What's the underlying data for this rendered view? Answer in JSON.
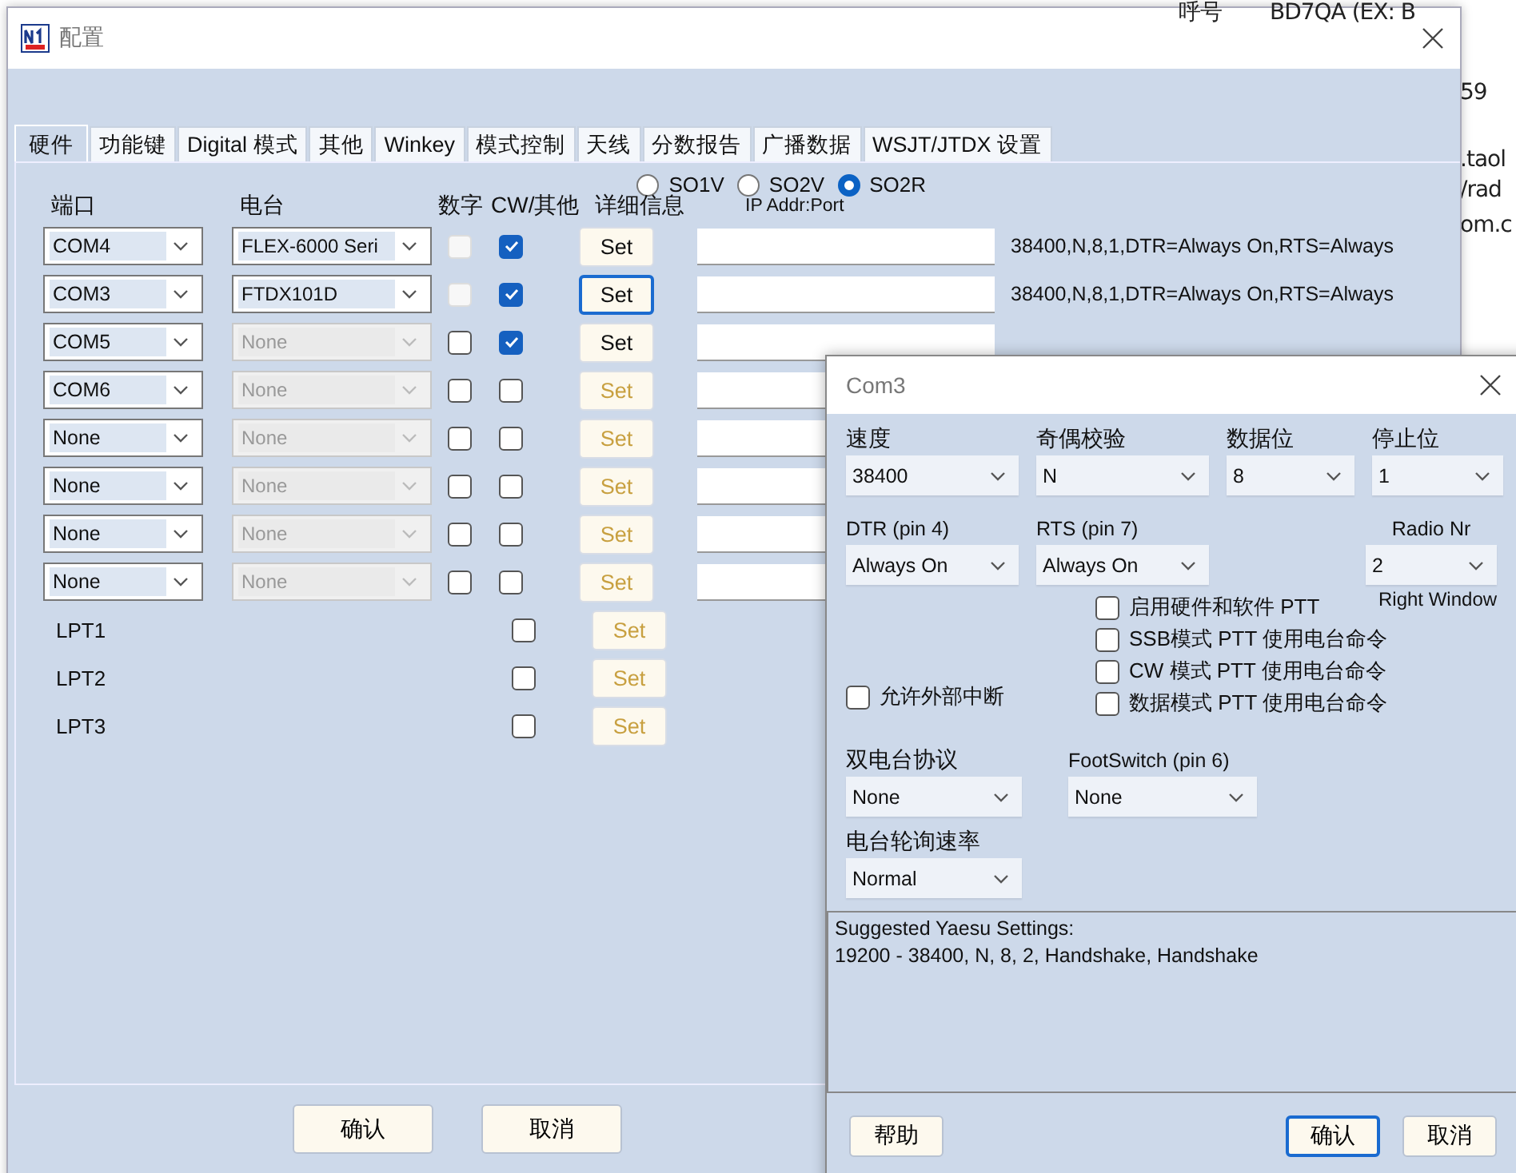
{
  "background_window": {
    "texts": [
      "呼号",
      "BD7QA (EX: B",
      "59",
      ".taol",
      "/rad",
      "om.c"
    ]
  },
  "window": {
    "title": "配置"
  },
  "tabs": [
    {
      "label": "硬件",
      "selected": true
    },
    {
      "label": "功能键",
      "selected": false
    },
    {
      "label": "Digital 模式",
      "selected": false
    },
    {
      "label": "其他",
      "selected": false
    },
    {
      "label": "Winkey",
      "selected": false
    },
    {
      "label": "模式控制",
      "selected": false
    },
    {
      "label": "天线",
      "selected": false
    },
    {
      "label": "分数报告",
      "selected": false
    },
    {
      "label": "广播数据",
      "selected": false
    },
    {
      "label": "WSJT/JTDX 设置",
      "selected": false
    }
  ],
  "mode_options": [
    {
      "label": "SO1V",
      "selected": false
    },
    {
      "label": "SO2V",
      "selected": false
    },
    {
      "label": "SO2R",
      "selected": true
    }
  ],
  "columns": [
    "端口",
    "电台",
    "数字",
    "CW/其他",
    "详细信息",
    "IP Addr:Port"
  ],
  "ports": [
    {
      "kind": "com",
      "port": "COM4",
      "radio": "FLEX-6000 Seri",
      "radio_disabled": false,
      "digital_checked": false,
      "digital_disabled": true,
      "cw_checked": true,
      "set_label": "Set",
      "set_enabled": true,
      "set_focused": false,
      "info": "38400,N,8,1,DTR=Always On,RTS=Always"
    },
    {
      "kind": "com",
      "port": "COM3",
      "radio": "FTDX101D",
      "radio_disabled": false,
      "digital_checked": false,
      "digital_disabled": true,
      "cw_checked": true,
      "set_label": "Set",
      "set_enabled": true,
      "set_focused": true,
      "info": "38400,N,8,1,DTR=Always On,RTS=Always"
    },
    {
      "kind": "com",
      "port": "COM5",
      "radio": "None",
      "radio_disabled": true,
      "digital_checked": false,
      "digital_disabled": false,
      "cw_checked": true,
      "set_label": "Set",
      "set_enabled": true,
      "set_focused": false
    },
    {
      "kind": "com",
      "port": "COM6",
      "radio": "None",
      "radio_disabled": true,
      "digital_checked": false,
      "digital_disabled": false,
      "cw_checked": false,
      "set_label": "Set",
      "set_enabled": false,
      "set_focused": false
    },
    {
      "kind": "com",
      "port": "None",
      "radio": "None",
      "radio_disabled": true,
      "digital_checked": false,
      "digital_disabled": false,
      "cw_checked": false,
      "set_label": "Set",
      "set_enabled": false,
      "set_focused": false
    },
    {
      "kind": "com",
      "port": "None",
      "radio": "None",
      "radio_disabled": true,
      "digital_checked": false,
      "digital_disabled": false,
      "cw_checked": false,
      "set_label": "Set",
      "set_enabled": false,
      "set_focused": false
    },
    {
      "kind": "com",
      "port": "None",
      "radio": "None",
      "radio_disabled": true,
      "digital_checked": false,
      "digital_disabled": false,
      "cw_checked": false,
      "set_label": "Set",
      "set_enabled": false,
      "set_focused": false
    },
    {
      "kind": "com",
      "port": "None",
      "radio": "None",
      "radio_disabled": true,
      "digital_checked": false,
      "digital_disabled": false,
      "cw_checked": false,
      "set_label": "Set",
      "set_enabled": false,
      "set_focused": false
    },
    {
      "kind": "lpt",
      "port": "LPT1",
      "cw_checked": false,
      "set_label": "Set",
      "set_enabled": false,
      "set_focused": false
    },
    {
      "kind": "lpt",
      "port": "LPT2",
      "cw_checked": false,
      "set_label": "Set",
      "set_enabled": false,
      "set_focused": false
    },
    {
      "kind": "lpt",
      "port": "LPT3",
      "cw_checked": false,
      "set_label": "Set",
      "set_enabled": false,
      "set_focused": false
    }
  ],
  "buttons": [
    {
      "label": "确认"
    },
    {
      "label": "取消"
    }
  ],
  "com_dialog": {
    "title": "Com3",
    "row1": [
      {
        "label": "速度",
        "value": "38400"
      },
      {
        "label": "奇偶校验",
        "value": "N"
      },
      {
        "label": "数据位",
        "value": "8"
      },
      {
        "label": "停止位",
        "value": "1"
      }
    ],
    "dtr": {
      "label": "DTR (pin 4)",
      "value": "Always On"
    },
    "rts": {
      "label": "RTS (pin 7)",
      "value": "Always On"
    },
    "radio_nr": {
      "label": "Radio Nr",
      "value": "2",
      "note": "Right Window"
    },
    "ptt_options": [
      {
        "label": "启用硬件和软件 PTT",
        "checked": false
      },
      {
        "label": "SSB模式 PTT 使用电台命令",
        "checked": false
      },
      {
        "label": "CW 模式 PTT 使用电台命令",
        "checked": false
      },
      {
        "label": "数据模式 PTT 使用电台命令",
        "checked": false
      }
    ],
    "external_interrupt": {
      "label": "允许外部中断",
      "checked": false
    },
    "so2r": {
      "label": "双电台协议",
      "value": "None"
    },
    "footswitch": {
      "label": "FootSwitch (pin 6)",
      "value": "None"
    },
    "polling": {
      "label": "电台轮询速率",
      "value": "Normal"
    },
    "notes": [
      "Suggested Yaesu Settings:",
      "19200 - 38400, N, 8, 2, Handshake, Handshake"
    ],
    "buttons": [
      {
        "label": "帮助",
        "focused": false
      },
      {
        "label": "确认",
        "focused": true
      },
      {
        "label": "取消",
        "focused": false
      }
    ]
  }
}
